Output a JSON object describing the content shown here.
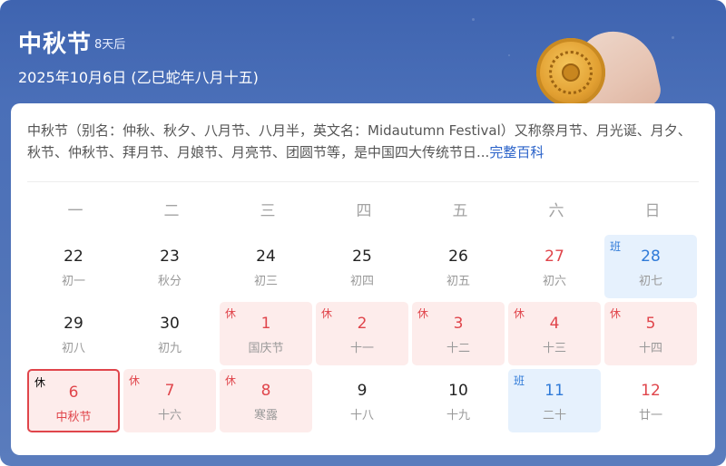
{
  "header": {
    "title": "中秋节",
    "countdown": "8天后",
    "date_line": "2025年10月6日 (乙巳蛇年八月十五)"
  },
  "description": {
    "text": "中秋节（别名：仲秋、秋夕、八月节、八月半，英文名：Midautumn Festival）又称祭月节、月光诞、月夕、秋节、仲秋节、拜月节、月娘节、月亮节、团圆节等，是中国四大传统节日...",
    "more_link": "完整百科"
  },
  "weekdays": [
    "一",
    "二",
    "三",
    "四",
    "五",
    "六",
    "日"
  ],
  "colors": {
    "holiday_red": "#e0454b",
    "holiday_bg": "#fdeceb",
    "workday_blue": "#2f7ad8",
    "workday_bg": "#e6f1fd",
    "header_blue": "#4a6fb8"
  },
  "calendar": {
    "rows": [
      [
        {
          "day": "22",
          "lunar": "初一",
          "tag": "",
          "type": "normal"
        },
        {
          "day": "23",
          "lunar": "秋分",
          "tag": "",
          "type": "normal"
        },
        {
          "day": "24",
          "lunar": "初三",
          "tag": "",
          "type": "normal"
        },
        {
          "day": "25",
          "lunar": "初四",
          "tag": "",
          "type": "normal"
        },
        {
          "day": "26",
          "lunar": "初五",
          "tag": "",
          "type": "normal"
        },
        {
          "day": "27",
          "lunar": "初六",
          "tag": "",
          "type": "sat"
        },
        {
          "day": "28",
          "lunar": "初七",
          "tag": "班",
          "type": "workday"
        }
      ],
      [
        {
          "day": "29",
          "lunar": "初八",
          "tag": "",
          "type": "normal"
        },
        {
          "day": "30",
          "lunar": "初九",
          "tag": "",
          "type": "normal"
        },
        {
          "day": "1",
          "lunar": "国庆节",
          "tag": "休",
          "type": "holiday"
        },
        {
          "day": "2",
          "lunar": "十一",
          "tag": "休",
          "type": "holiday"
        },
        {
          "day": "3",
          "lunar": "十二",
          "tag": "休",
          "type": "holiday"
        },
        {
          "day": "4",
          "lunar": "十三",
          "tag": "休",
          "type": "holiday"
        },
        {
          "day": "5",
          "lunar": "十四",
          "tag": "休",
          "type": "holiday"
        }
      ],
      [
        {
          "day": "6",
          "lunar": "中秋节",
          "tag": "休",
          "type": "selected"
        },
        {
          "day": "7",
          "lunar": "十六",
          "tag": "休",
          "type": "holiday"
        },
        {
          "day": "8",
          "lunar": "寒露",
          "tag": "休",
          "type": "holiday"
        },
        {
          "day": "9",
          "lunar": "十八",
          "tag": "",
          "type": "normal"
        },
        {
          "day": "10",
          "lunar": "十九",
          "tag": "",
          "type": "normal"
        },
        {
          "day": "11",
          "lunar": "二十",
          "tag": "班",
          "type": "workday"
        },
        {
          "day": "12",
          "lunar": "廿一",
          "tag": "",
          "type": "sun"
        }
      ]
    ]
  }
}
